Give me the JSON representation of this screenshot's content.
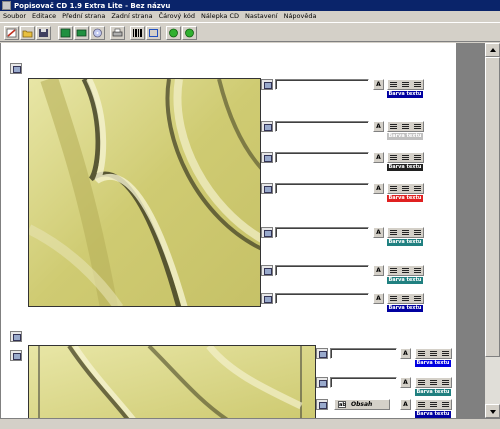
{
  "window": {
    "title": "Popisovač CD 1.9 Extra Lite - Bez názvu"
  },
  "menu": [
    {
      "label": "Soubor"
    },
    {
      "label": "Editace"
    },
    {
      "label": "Přední strana"
    },
    {
      "label": "Zadní strana"
    },
    {
      "label": "Čárový kód"
    },
    {
      "label": "Nálepka CD"
    },
    {
      "label": "Nastavení"
    },
    {
      "label": "Nápověda"
    }
  ],
  "toolbar": [
    {
      "icon": "pencil-new-icon"
    },
    {
      "icon": "open-folder-icon"
    },
    {
      "icon": "save-disk-icon"
    },
    {
      "icon": "front-cover-icon"
    },
    {
      "icon": "back-cover-icon"
    },
    {
      "icon": "cd-label-icon"
    },
    {
      "icon": "print-icon"
    },
    {
      "icon": "barcode-icon"
    },
    {
      "icon": "frame-icon"
    },
    {
      "icon": "green-circle-icon"
    },
    {
      "icon": "green-circle-2-icon"
    }
  ],
  "front_panel": {
    "rows": [
      {
        "value": "",
        "font_label": "A",
        "color_label": "Barva textu",
        "color": "#0000a0"
      },
      {
        "value": "",
        "font_label": "A",
        "color_label": "Barva textu",
        "color": "#c0c0c0"
      },
      {
        "value": "",
        "font_label": "A",
        "color_label": "Barva textu",
        "color": "#202020"
      },
      {
        "value": "",
        "font_label": "A",
        "color_label": "Barva textu",
        "color": "#e02020"
      },
      {
        "value": "",
        "font_label": "A",
        "color_label": "Barva textu",
        "color": "#208080"
      },
      {
        "value": "",
        "font_label": "A",
        "color_label": "Barva textu",
        "color": "#208080"
      },
      {
        "value": "",
        "font_label": "A",
        "color_label": "Barva textu",
        "color": "#0000a0"
      }
    ]
  },
  "back_panel": {
    "rows": [
      {
        "value": "",
        "font_label": "A",
        "color_label": "Barva textu",
        "color": "#0000e0"
      },
      {
        "value": "",
        "font_label": "A",
        "color_label": "Barva textu",
        "color": "#208080"
      }
    ],
    "contents_button": {
      "label": "Obsah",
      "icon_text": "ab"
    },
    "contents_color_label": "Barva textu",
    "contents_color": "#0000a0"
  },
  "colors": {
    "titlebar": "#0a246a",
    "page": "#ffffff",
    "workspace": "#808080",
    "art_base": "#d6d37f"
  }
}
